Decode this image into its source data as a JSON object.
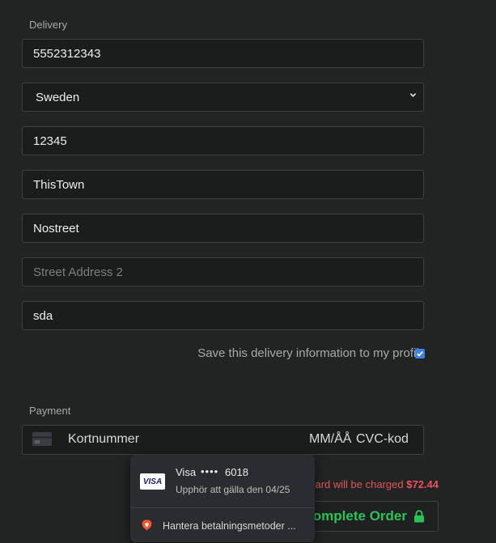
{
  "delivery": {
    "section_label": "Delivery",
    "phone": "5552312343",
    "country": "Sweden",
    "postal_code": "12345",
    "city": "ThisTown",
    "street": "Nostreet",
    "street2_placeholder": "Street Address 2",
    "extra": "sda",
    "save_label": "Save this delivery information to my profile",
    "save_checked": true
  },
  "payment": {
    "section_label": "Payment",
    "card_placeholder": "Kortnummer",
    "expiry_placeholder": "MM/ÅÅ",
    "cvc_placeholder": "CVC-kod",
    "charge_text": "card will be charged",
    "charge_amount": "$72.44",
    "complete_label": "Complete Order"
  },
  "autofill_popup": {
    "brand": "Visa",
    "masked_dots": "••••",
    "last4": "6018",
    "expiry": "Upphör att gälla den 04/25",
    "badge": "VISA",
    "manage_label": "Hantera betalningsmetoder ..."
  },
  "colors": {
    "background": "#222323",
    "field_background": "#1b1c1c",
    "accent_green": "#2cc25a",
    "charge_red": "#f0505c",
    "checkbox_blue": "#3d83e6"
  },
  "icons": [
    "chevron-down-icon",
    "checkmark-icon",
    "credit-card-icon",
    "lock-icon",
    "visa-icon",
    "brave-lion-icon"
  ]
}
